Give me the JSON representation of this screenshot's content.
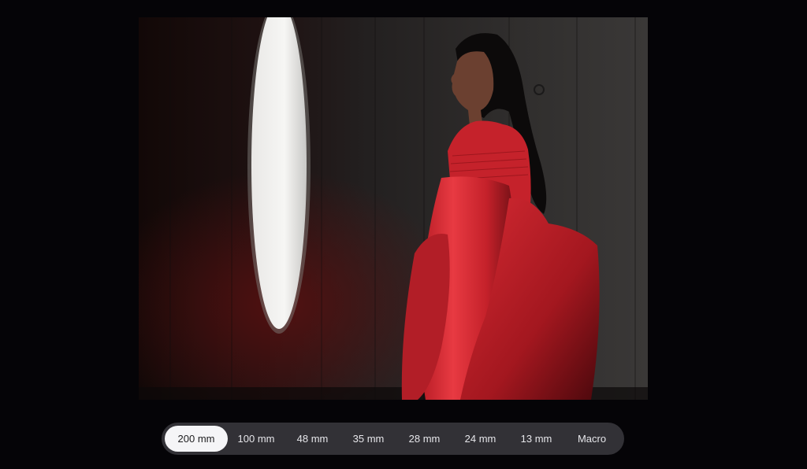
{
  "photo": {
    "colors": {
      "dress": "#e02a33",
      "wall": "#2a2928",
      "window": "#f1f0ee"
    }
  },
  "focal_selector": {
    "selected": "200 mm",
    "options": [
      "200 mm",
      "100 mm",
      "48 mm",
      "35 mm",
      "28 mm",
      "24 mm",
      "13 mm",
      "Macro"
    ]
  }
}
